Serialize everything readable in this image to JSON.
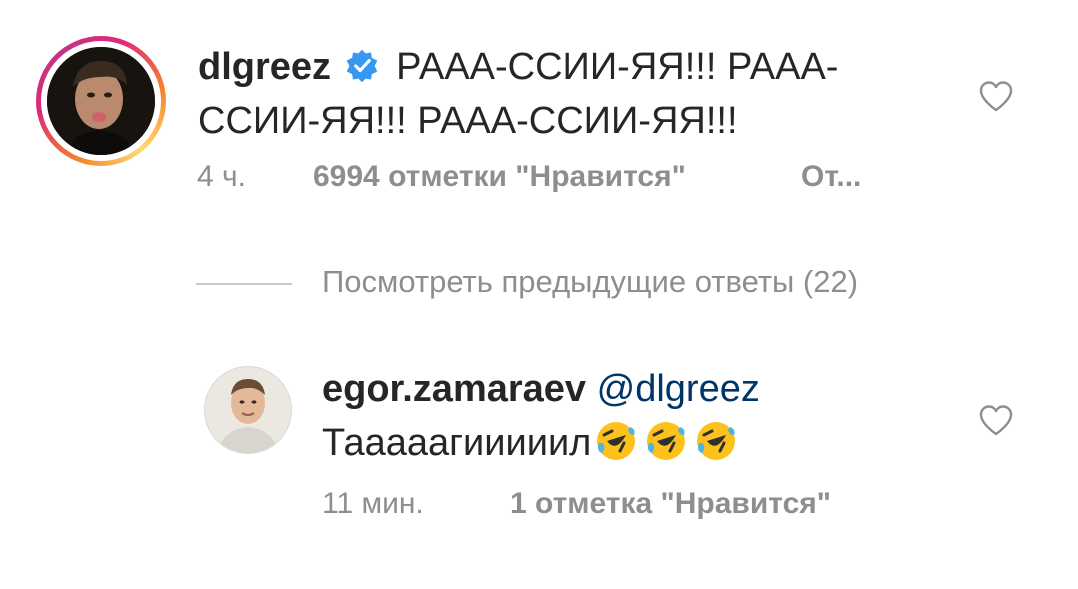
{
  "main_comment": {
    "username": "dlgreez",
    "verified_icon": "verified-badge-icon",
    "text": "РААА-ССИИ-ЯЯ!!! РААА-ССИИ-ЯЯ!!! РААА-ССИИ-ЯЯ!!!",
    "time": "4 ч.",
    "likes": "6994 отметки \"Нравится\"",
    "reply_label": "От...",
    "avatar_ring_colors": [
      "#f58529",
      "#dd2a7b",
      "#c13584",
      "#feda77"
    ]
  },
  "view_previous_replies": {
    "label": "Посмотреть предыдущие ответы (22)"
  },
  "reply_comment": {
    "username": "egor.zamaraev",
    "mention": "@dlgreez",
    "text": "Тааааагииииил",
    "emoji": [
      "rolling-on-floor-laughing-icon",
      "rolling-on-floor-laughing-icon",
      "rolling-on-floor-laughing-icon"
    ],
    "time": "11 мин.",
    "likes": "1 отметка \"Нравится\""
  },
  "colors": {
    "text": "#262626",
    "secondary": "#8e8e8e",
    "mention": "#003569",
    "verified": "#3897f0"
  }
}
